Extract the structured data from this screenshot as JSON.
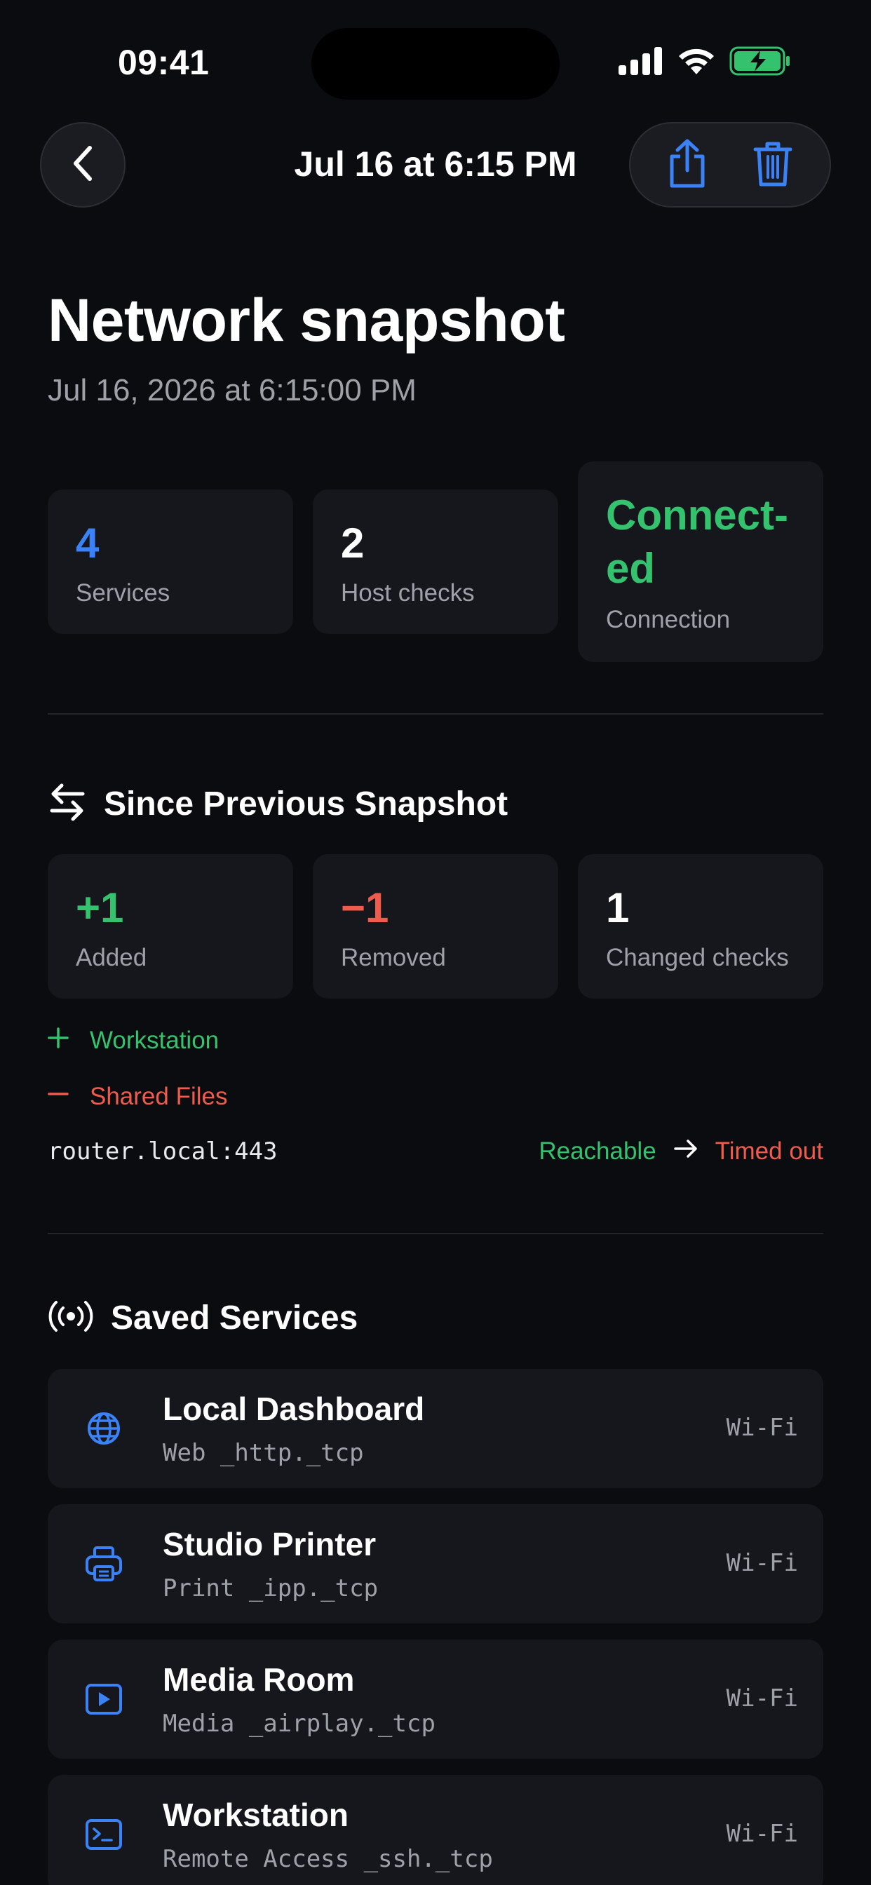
{
  "status_bar": {
    "time": "09:41"
  },
  "nav": {
    "title": "Jul 16 at 6:15 PM"
  },
  "header": {
    "title": "Network snapshot",
    "subtitle": "Jul 16, 2026 at 6:15:00 PM"
  },
  "stats": [
    {
      "value": "4",
      "label": "Services"
    },
    {
      "value": "2",
      "label": "Host checks"
    },
    {
      "value_line1": "Connect-",
      "value_line2": "ed",
      "label": "Connection"
    }
  ],
  "since_previous": {
    "title": "Since Previous Snapshot",
    "cards": [
      {
        "value": "+1",
        "label": "Added"
      },
      {
        "value": "−1",
        "label": "Removed"
      },
      {
        "value": "1",
        "label": "Changed checks"
      }
    ],
    "added": [
      "Workstation"
    ],
    "removed": [
      "Shared Files"
    ],
    "changed_check": {
      "host": "router.local:443",
      "from": "Reachable",
      "to": "Timed out"
    }
  },
  "saved_services": {
    "title": "Saved Services",
    "items": [
      {
        "name": "Local Dashboard",
        "sub": "Web _http._tcp",
        "iface": "Wi-Fi",
        "icon": "globe-icon"
      },
      {
        "name": "Studio Printer",
        "sub": "Print _ipp._tcp",
        "iface": "Wi-Fi",
        "icon": "printer-icon"
      },
      {
        "name": "Media Room",
        "sub": "Media _airplay._tcp",
        "iface": "Wi-Fi",
        "icon": "play-icon"
      },
      {
        "name": "Workstation",
        "sub": "Remote Access _ssh._tcp",
        "iface": "Wi-Fi",
        "icon": "terminal-icon"
      }
    ]
  },
  "colors": {
    "accent_blue": "#3b82f6",
    "green": "#34c26e",
    "red": "#ef5b4c",
    "background": "#0b0c10",
    "card": "#16171c"
  }
}
